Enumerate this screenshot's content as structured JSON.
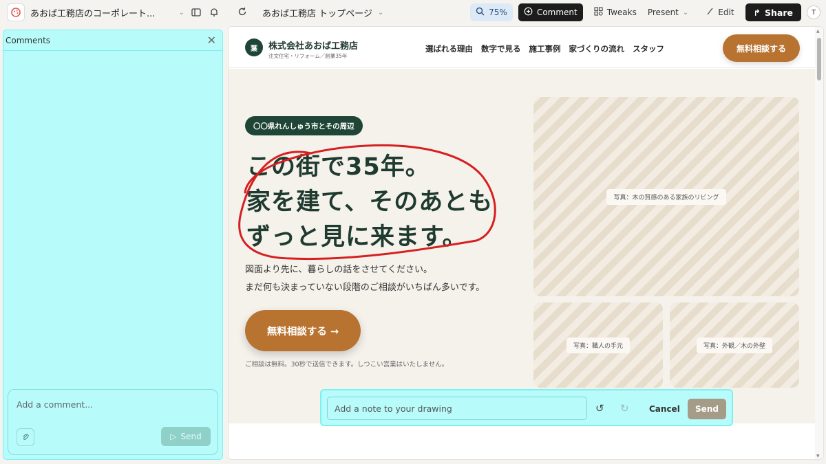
{
  "app": {
    "project_title": "あおば工務店のコーポレート...",
    "page_name": "あおば工務店 トップページ"
  },
  "toolbar": {
    "zoom": "75%",
    "comment_label": "Comment",
    "tweaks_label": "Tweaks",
    "present_label": "Present",
    "edit_label": "Edit",
    "share_label": "Share",
    "avatar_initial": "T"
  },
  "comments_panel": {
    "title": "Comments",
    "placeholder": "Add a comment...",
    "send_label": "Send"
  },
  "site": {
    "logo_char": "葉",
    "brand_name": "株式会社あおば工務店",
    "brand_sub": "注文住宅・リフォーム／創業35年",
    "nav": [
      "選ばれる理由",
      "数字で見る",
      "施工事例",
      "家づくりの流れ",
      "スタッフ"
    ],
    "header_cta": "無料相談する",
    "tag": "〇〇県れんしゅう市とその周辺",
    "headline": [
      "この街で35年。",
      "家を建て、そのあとも",
      "ずっと見に来ます。"
    ],
    "lead": [
      "図面より先に、暮らしの話をさせてください。",
      "まだ何も決まっていない段階のご相談がいちばん多いです。"
    ],
    "hero_cta": "無料相談する →",
    "note": "ご相談は無料。30秒で送信できます。しつこい営業はいたしません。",
    "photos": [
      "写真：木の質感のある家族のリビング",
      "写真：職人の手元",
      "写真：外観／木の外壁"
    ]
  },
  "drawing_bar": {
    "placeholder": "Add a note to your drawing",
    "cancel_label": "Cancel",
    "send_label": "Send"
  },
  "colors": {
    "accent_green": "#1f4536",
    "accent_brown": "#b87330",
    "highlight_cyan": "#b8fbfb",
    "annotation_red": "#d62020"
  }
}
